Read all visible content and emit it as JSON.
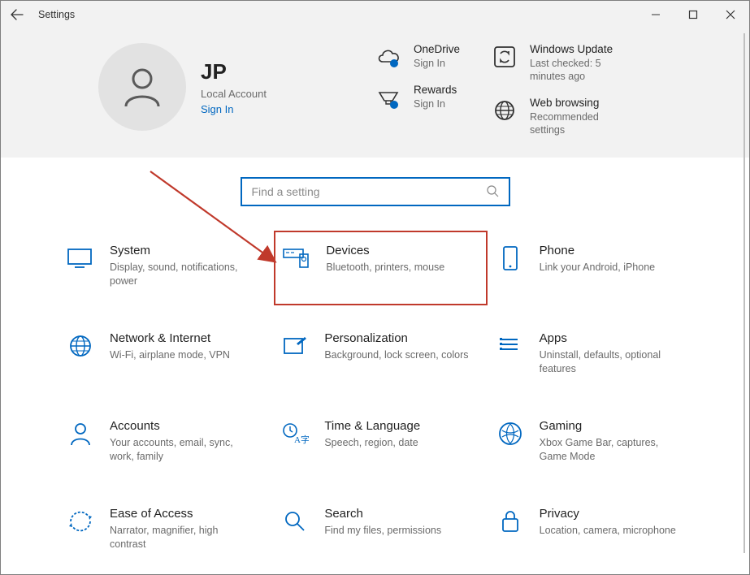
{
  "titlebar": {
    "title": "Settings"
  },
  "user": {
    "name": "JP",
    "type": "Local Account",
    "signin": "Sign In"
  },
  "info": {
    "onedrive": {
      "title": "OneDrive",
      "sub": "Sign In"
    },
    "rewards": {
      "title": "Rewards",
      "sub": "Sign In"
    },
    "update": {
      "title": "Windows Update",
      "sub": "Last checked: 5 minutes ago"
    },
    "browsing": {
      "title": "Web browsing",
      "sub": "Recommended settings"
    }
  },
  "search": {
    "placeholder": "Find a setting"
  },
  "categories": {
    "system": {
      "title": "System",
      "sub": "Display, sound, notifications, power"
    },
    "devices": {
      "title": "Devices",
      "sub": "Bluetooth, printers, mouse"
    },
    "phone": {
      "title": "Phone",
      "sub": "Link your Android, iPhone"
    },
    "network": {
      "title": "Network & Internet",
      "sub": "Wi-Fi, airplane mode, VPN"
    },
    "personal": {
      "title": "Personalization",
      "sub": "Background, lock screen, colors"
    },
    "apps": {
      "title": "Apps",
      "sub": "Uninstall, defaults, optional features"
    },
    "accounts": {
      "title": "Accounts",
      "sub": "Your accounts, email, sync, work, family"
    },
    "time": {
      "title": "Time & Language",
      "sub": "Speech, region, date"
    },
    "gaming": {
      "title": "Gaming",
      "sub": "Xbox Game Bar, captures, Game Mode"
    },
    "ease": {
      "title": "Ease of Access",
      "sub": "Narrator, magnifier, high contrast"
    },
    "searchcat": {
      "title": "Search",
      "sub": "Find my files, permissions"
    },
    "privacy": {
      "title": "Privacy",
      "sub": "Location, camera, microphone"
    }
  }
}
